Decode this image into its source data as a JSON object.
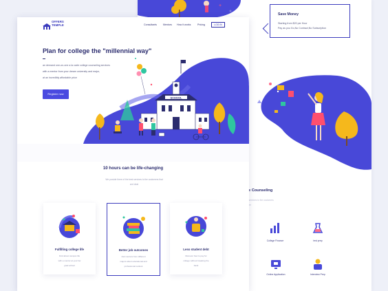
{
  "brand": {
    "line1": "OFFERS",
    "line2": "TEMPLE"
  },
  "nav": {
    "items": [
      "Consultants",
      "Mentors",
      "How it works",
      "Pricing"
    ],
    "login": "LOG IN"
  },
  "hero": {
    "title": "Plan for college the \"millennial way\"",
    "desc_lines": [
      "an demand one-on-one a la carte college counseling services",
      "with a mentor from your dream university and major,",
      "at an incredibly affordable price"
    ],
    "cta": "Register now",
    "school_sign": "SCHOOL"
  },
  "section": {
    "title": "10 hours can be life-changing",
    "subtitle_lines": [
      "We provide three of the best services to the customers that",
      "are ideal"
    ]
  },
  "cards": [
    {
      "title": "Fulfilling college life",
      "lines": [
        "Find about campus life",
        "with a mentor at your fav",
        "grad school"
      ]
    },
    {
      "title": "Better job outcomes",
      "lines": [
        "Ask mentors from different",
        "majors about educational and",
        "professional outlook"
      ]
    },
    {
      "title": "Less student debt",
      "lines": [
        "Discover how to pay for",
        "college without breaking the",
        "bank"
      ]
    }
  ],
  "tooltip": {
    "title": "Save Money",
    "lines": [
      "Starting from $20 per Hour",
      "Pay as you Go,No Contract,No Subscription"
    ]
  },
  "counseling": {
    "title_visible": "rete Counseling",
    "sub_lines": [
      "ciate services to the customers",
      "that are"
    ]
  },
  "services": [
    "College Finance",
    "test prep",
    "Online Application",
    "Interview Prep"
  ],
  "colors": {
    "primary": "#4a4ae0",
    "navy": "#2b2c6e",
    "blob": "#4848d8",
    "yellow": "#f5b81c"
  }
}
